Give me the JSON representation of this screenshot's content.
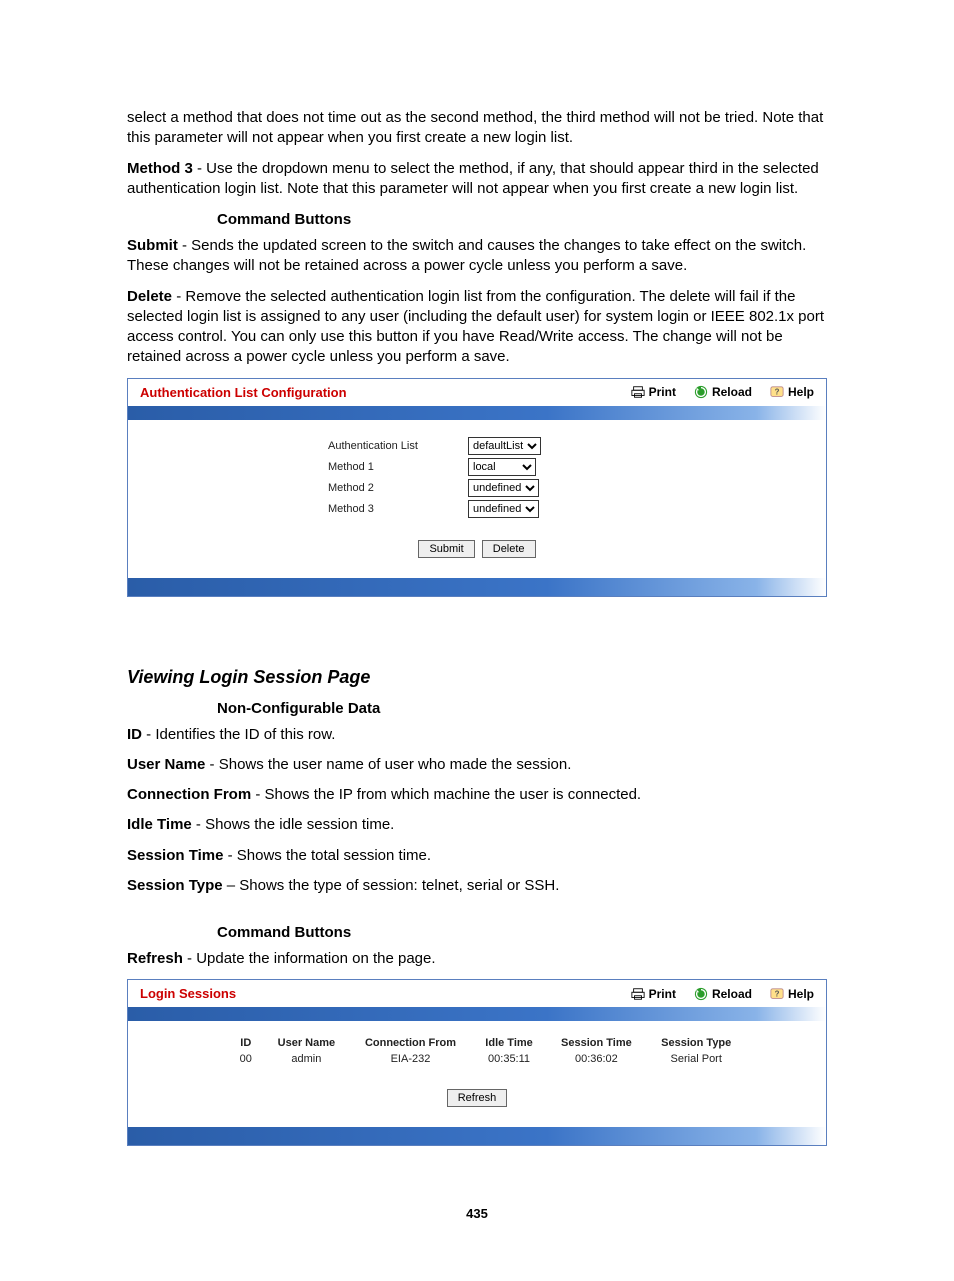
{
  "intro": {
    "p1": "select a method that does not time out as the second method, the third method will not be tried. Note that this parameter will not appear when you first create a new login list.",
    "method3_label": "Method 3",
    "method3_text": " - Use the dropdown menu to select the method, if any, that should appear third in the selected authentication login list. Note that this parameter will not appear when you first create a new login list.",
    "cmd_head": "Command Buttons",
    "submit_label": "Submit",
    "submit_text": " - Sends the updated screen to the switch and causes the changes to take effect on the switch. These changes will not be retained across a power cycle unless you perform a save.",
    "delete_label": "Delete",
    "delete_text": " - Remove the selected authentication login list from the configuration. The delete will fail if the selected login list is assigned to any user (including the default user) for system login or IEEE 802.1x port access control. You can only use this button if you have Read/Write access. The change will not be retained across a power cycle unless you perform a save."
  },
  "panel1": {
    "title": "Authentication List Configuration",
    "print": "Print",
    "reload": "Reload",
    "help": "Help",
    "labels": {
      "auth_list": "Authentication List",
      "m1": "Method 1",
      "m2": "Method 2",
      "m3": "Method 3"
    },
    "values": {
      "auth_list": "defaultList",
      "m1": "local",
      "m2": "undefined",
      "m3": "undefined"
    },
    "submit": "Submit",
    "delete": "Delete"
  },
  "section2": {
    "title": "Viewing Login Session Page",
    "nonconfig_head": "Non-Configurable Data",
    "id_label": "ID",
    "id_text": " - Identifies the ID of this row.",
    "user_label": "User Name",
    "user_text": " - Shows the user name of user who made the session.",
    "conn_label": "Connection From",
    "conn_text": " - Shows the IP from which machine the user is connected.",
    "idle_label": "Idle Time",
    "idle_text": " - Shows the idle session time.",
    "sess_label": "Session Time",
    "sess_text": " - Shows the total session time.",
    "type_label": "Session Type",
    "type_text": " – Shows the type of session: telnet, serial or SSH.",
    "cmd_head": "Command Buttons",
    "refresh_label": "Refresh",
    "refresh_text": " - Update the information on the page."
  },
  "panel2": {
    "title": "Login Sessions",
    "print": "Print",
    "reload": "Reload",
    "help": "Help",
    "headers": {
      "id": "ID",
      "user": "User Name",
      "conn": "Connection From",
      "idle": "Idle Time",
      "sess": "Session Time",
      "type": "Session Type"
    },
    "row": {
      "id": "00",
      "user": "admin",
      "conn": "EIA-232",
      "idle": "00:35:11",
      "sess": "00:36:02",
      "type": "Serial Port"
    },
    "refresh": "Refresh"
  },
  "page_number": "435"
}
